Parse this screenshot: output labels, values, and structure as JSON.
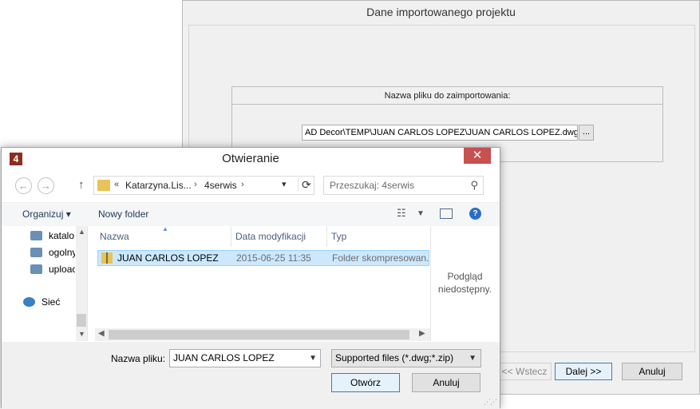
{
  "wizard": {
    "title": "Dane importowanego projektu",
    "file_group_label": "Nazwa pliku do zaimportowania:",
    "file_path_value": "AD Decor\\TEMP\\JUAN CARLOS LOPEZ\\JUAN CARLOS LOPEZ.dwg",
    "browse_label": "...",
    "back_label": "<< Wstecz",
    "next_label": "Dalej >>",
    "cancel_label": "Anuluj"
  },
  "dialog": {
    "title": "Otwieranie",
    "app_icon": "4",
    "close_glyph": "✕",
    "breadcrumb": {
      "prefix": "«",
      "segments": [
        "Katarzyna.Lis...",
        "4serwis"
      ]
    },
    "search_placeholder": "Przeszukaj: 4serwis",
    "toolbar": {
      "organize_label": "Organizuj ▾",
      "new_folder_label": "Nowy folder"
    },
    "nav_items": [
      {
        "label": "katalo",
        "icon": "network-drive-icon"
      },
      {
        "label": "ogolny",
        "icon": "network-drive-icon"
      },
      {
        "label": "uploac",
        "icon": "network-drive-icon"
      },
      {
        "label": "Sieć",
        "icon": "network-icon"
      }
    ],
    "columns": [
      "Nazwa",
      "Data modyfikacji",
      "Typ"
    ],
    "files": [
      {
        "name": "JUAN CARLOS LOPEZ",
        "modified": "2015-06-25 11:35",
        "type": "Folder skompresowan..."
      }
    ],
    "preview": {
      "line1": "Podgląd",
      "line2": "niedostępny."
    },
    "filename_label": "Nazwa pliku:",
    "filename_value": "JUAN CARLOS LOPEZ",
    "filetype_value": "Supported files (*.dwg;*.zip)",
    "open_label": "Otwórz",
    "cancel_label": "Anuluj"
  },
  "colors": {
    "accent": "#3c7fb1",
    "selection": "#cce8ff",
    "close_button": "#c75050"
  }
}
